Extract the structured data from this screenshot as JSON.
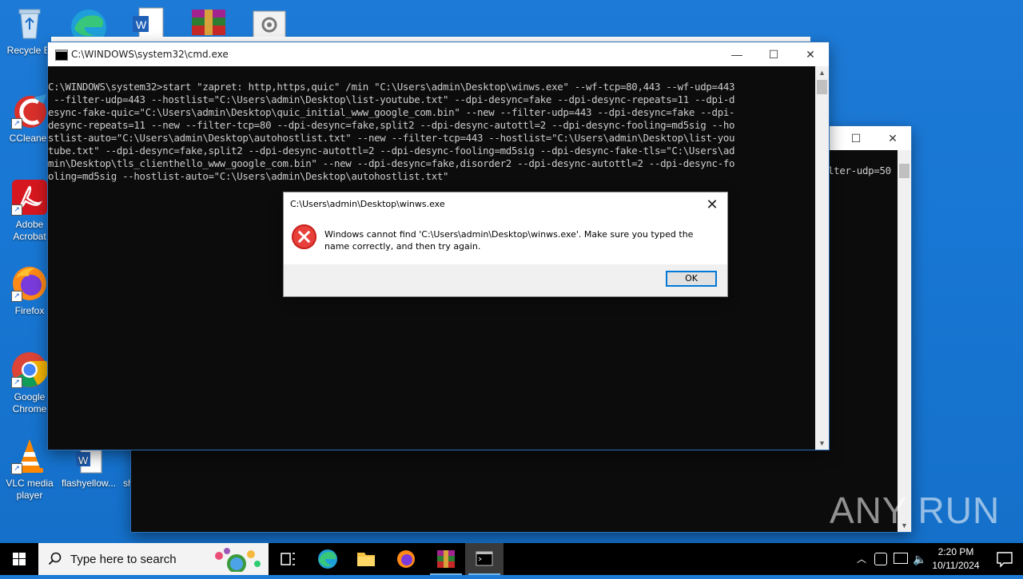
{
  "desktop": {
    "icons": [
      {
        "label": "Recycle Bin",
        "display": "Recycle Bi"
      },
      {
        "label": "CCleaner",
        "display": "CCleaner"
      },
      {
        "label": "Adobe Acrobat",
        "display": "Adobe Acrobat"
      },
      {
        "label": "Firefox",
        "display": "Firefox"
      },
      {
        "label": "Google Chrome",
        "display": "Google Chrome"
      },
      {
        "label": "VLC media player",
        "display": "VLC media player"
      },
      {
        "label": "flashyellow...",
        "display": "flashyellow..."
      },
      {
        "label": "sh",
        "display": "sh"
      }
    ]
  },
  "cmd_window": {
    "title": "C:\\WINDOWS\\system32\\cmd.exe",
    "minimize": "—",
    "maximize": "☐",
    "close": "✕",
    "console_text": "C:\\WINDOWS\\system32>start \"zapret: http,https,quic\" /min \"C:\\Users\\admin\\Desktop\\winws.exe\" --wf-tcp=80,443 --wf-udp=443\n --filter-udp=443 --hostlist=\"C:\\Users\\admin\\Desktop\\list-youtube.txt\" --dpi-desync=fake --dpi-desync-repeats=11 --dpi-d\nesync-fake-quic=\"C:\\Users\\admin\\Desktop\\quic_initial_www_google_com.bin\" --new --filter-udp=443 --dpi-desync=fake --dpi-\ndesync-repeats=11 --new --filter-tcp=80 --dpi-desync=fake,split2 --dpi-desync-autottl=2 --dpi-desync-fooling=md5sig --ho\nstlist-auto=\"C:\\Users\\admin\\Desktop\\autohostlist.txt\" --new --filter-tcp=443 --hostlist=\"C:\\Users\\admin\\Desktop\\list-you\ntube.txt\" --dpi-desync=fake,split2 --dpi-desync-autottl=2 --dpi-desync-fooling=md5sig --dpi-desync-fake-tls=\"C:\\Users\\ad\nmin\\Desktop\\tls_clienthello_www_google_com.bin\" --new --dpi-desync=fake,disorder2 --dpi-desync-autottl=2 --dpi-desync-fo\noling=md5sig --hostlist-auto=\"C:\\Users\\admin\\Desktop\\autohostlist.txt\""
  },
  "back_window": {
    "maximize": "☐",
    "close": "✕",
    "console_text": "lter-udp=50"
  },
  "dialog": {
    "title": "C:\\Users\\admin\\Desktop\\winws.exe",
    "close": "✕",
    "message": "Windows cannot find 'C:\\Users\\admin\\Desktop\\winws.exe'. Make sure you typed the name correctly, and then try again.",
    "ok_label": "OK"
  },
  "taskbar": {
    "search_placeholder": "Type here to search",
    "clock_time": "2:20 PM",
    "clock_date": "10/11/2024"
  },
  "watermark": "ANY RUN",
  "colors": {
    "desktop": "#1877d4",
    "dialog_error": "#e8413b",
    "ok_border": "#0078d7"
  }
}
